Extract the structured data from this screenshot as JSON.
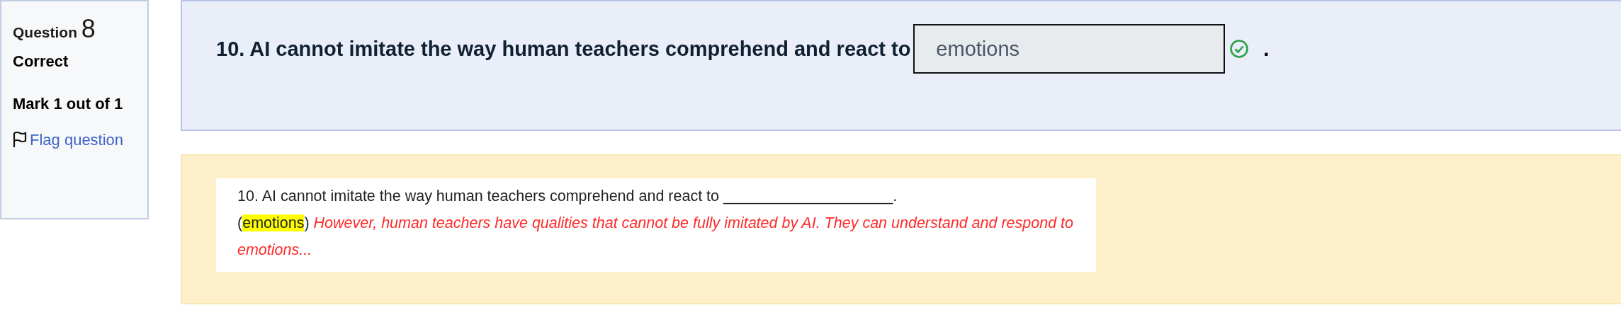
{
  "info": {
    "question_label": "Question",
    "number": "8",
    "state": "Correct",
    "mark": "Mark 1 out of 1",
    "flag": {
      "label": "Flag question",
      "flagged": false
    }
  },
  "question": {
    "text": "10. AI cannot imitate the way human teachers comprehend and react to",
    "answer": "emotions",
    "correct": true,
    "suffix": "."
  },
  "feedback": {
    "line": "10. AI cannot imitate the way human teachers comprehend and react to ____________________.",
    "open_paren": "(",
    "highlighted": "emotions",
    "close_paren": ")",
    "explanation": "However, human teachers have qualities that cannot be fully imitated by AI. They can understand and respond to emotions..."
  }
}
